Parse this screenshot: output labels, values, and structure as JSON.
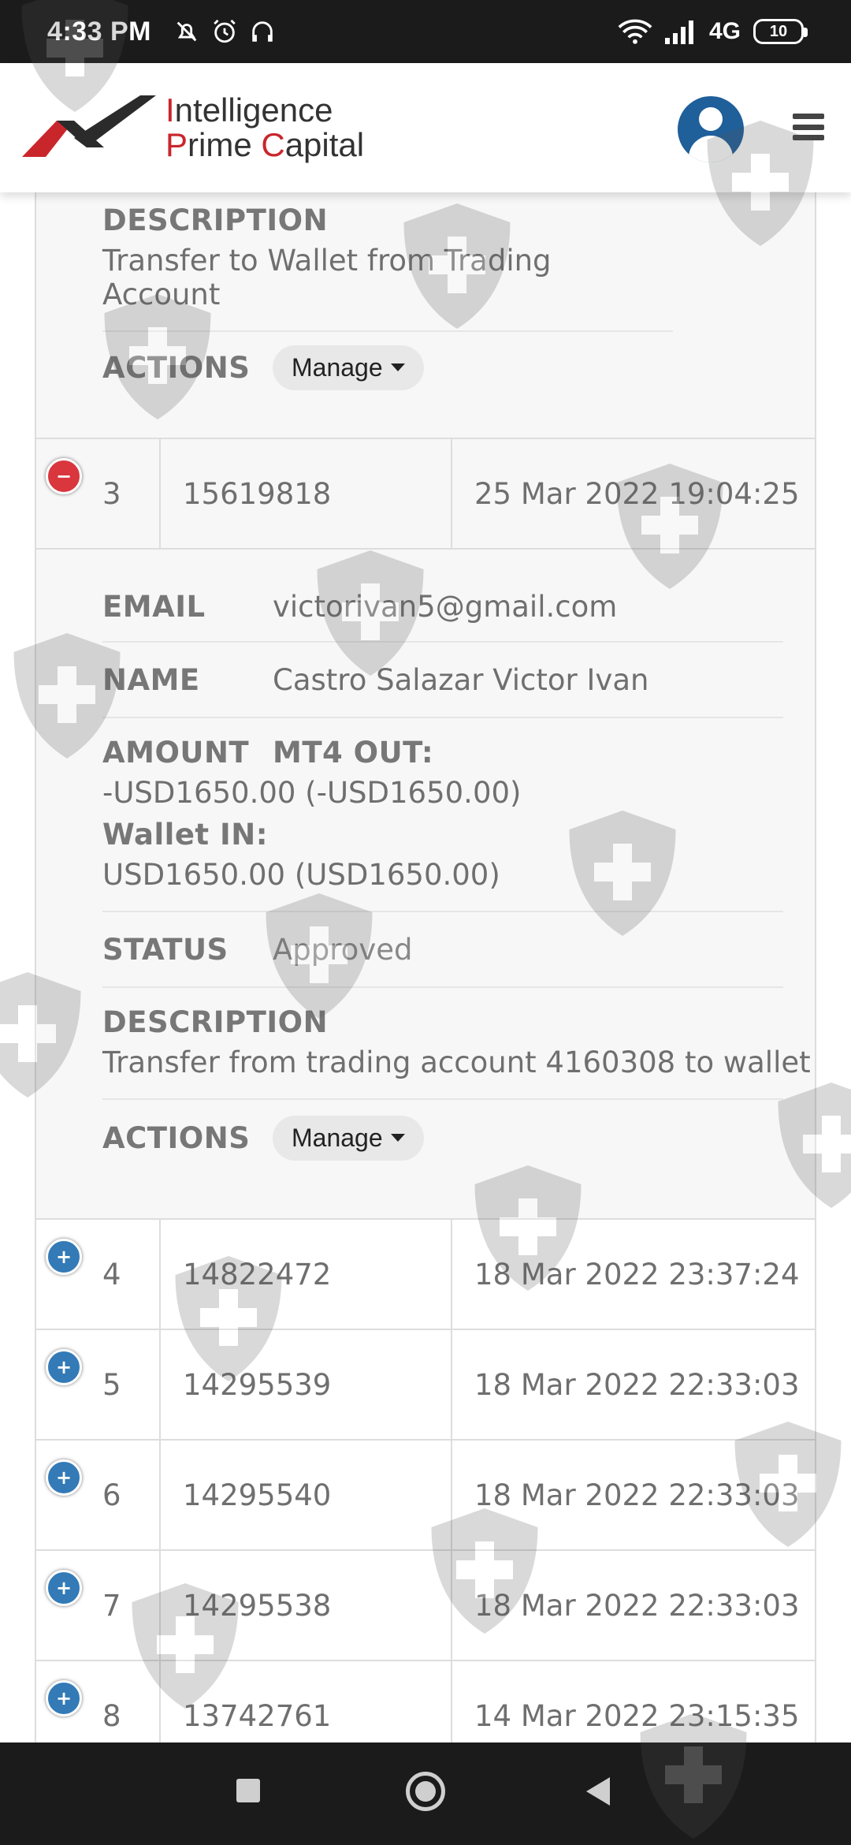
{
  "status_bar": {
    "time": "4:33 PM",
    "network": "4G",
    "battery": "10",
    "icons": [
      "mute-bell-icon",
      "alarm-icon",
      "headset-icon",
      "wifi-icon",
      "signal-icon",
      "battery-icon"
    ]
  },
  "header": {
    "logo_line1_prefix": "I",
    "logo_line1_rest": "ntelligence",
    "logo_line2_p": "P",
    "logo_line2_rime": "rime ",
    "logo_line2_c": "C",
    "logo_line2_apital": "apital",
    "brand_color": "#c9262c",
    "avatar_color": "#1f5f9a"
  },
  "prev_detail": {
    "description_label": "DESCRIPTION",
    "description_value": "Transfer to Wallet from Trading Account",
    "actions_label": "ACTIONS",
    "manage_label": "Manage"
  },
  "expanded_row": {
    "index": "3",
    "id": "15619818",
    "date": "25 Mar 2022 19:04:25",
    "toggle": "−"
  },
  "detail": {
    "email_label": "EMAIL",
    "email_value": "victorivan5@gmail.com",
    "name_label": "NAME",
    "name_value": "Castro Salazar Victor Ivan",
    "amount_label": "AMOUNT",
    "mt4_label": "MT4 OUT:",
    "mt4_value": "-USD1650.00 (-USD1650.00)",
    "wallet_label": "Wallet IN:",
    "wallet_value": "USD1650.00 (USD1650.00)",
    "status_label": "STATUS",
    "status_value": "Approved",
    "description_label": "DESCRIPTION",
    "description_value": "Transfer from trading account 4160308 to wallet",
    "actions_label": "ACTIONS",
    "manage_label": "Manage"
  },
  "rows": [
    {
      "index": "4",
      "id": "14822472",
      "date": "18 Mar 2022 23:37:24",
      "toggle": "+"
    },
    {
      "index": "5",
      "id": "14295539",
      "date": "18 Mar 2022 22:33:03",
      "toggle": "+"
    },
    {
      "index": "6",
      "id": "14295540",
      "date": "18 Mar 2022 22:33:03",
      "toggle": "+"
    },
    {
      "index": "7",
      "id": "14295538",
      "date": "18 Mar 2022 22:33:03",
      "toggle": "+"
    },
    {
      "index": "8",
      "id": "13742761",
      "date": "14 Mar 2022 23:15:35",
      "toggle": "+"
    }
  ],
  "colors": {
    "expand_button": "#337ab7",
    "collapse_button": "#d9363e"
  }
}
